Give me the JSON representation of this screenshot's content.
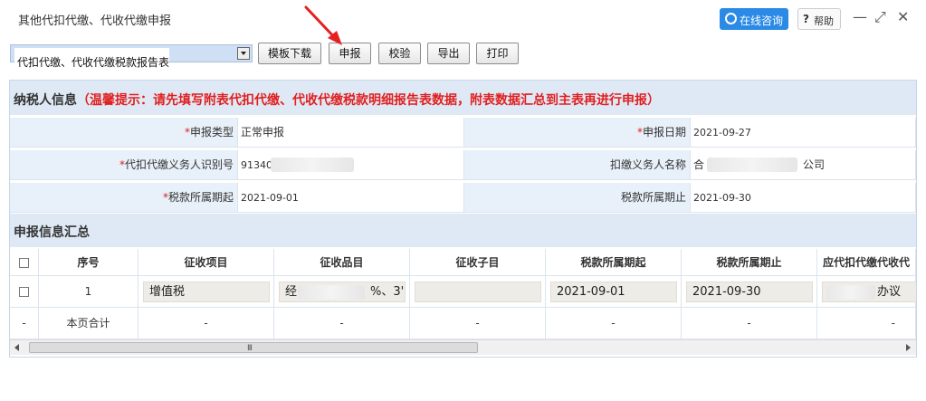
{
  "window": {
    "title": "其他代扣代缴、代收代缴申报",
    "consult_label": "在线咨询",
    "help_icon": "?",
    "help_label": "帮助",
    "minimize": "—",
    "maximize": "⤢",
    "close": "✕"
  },
  "toolbar": {
    "report_select": "代扣代缴、代收代缴税款报告表",
    "buttons": [
      "模板下载",
      "申报",
      "校验",
      "导出",
      "打印"
    ]
  },
  "taxpayer": {
    "section_title": "纳税人信息",
    "warning": "（温馨提示：请先填写附表代扣代缴、代收代缴税款明细报告表数据，附表数据汇总到主表再进行申报）",
    "required_mark": "*",
    "fields": {
      "report_type_label": "申报类型",
      "report_type": "正常申报",
      "report_date_label": "申报日期",
      "report_date": "2021-09-27",
      "agent_id_label": "代扣代缴义务人识别号",
      "agent_id": "91340",
      "agent_name_label": "扣缴义务人名称",
      "agent_name_prefix": "合",
      "agent_name_suffix": "公司",
      "period_start_label": "税款所属期起",
      "period_start": "2021-09-01",
      "period_end_label": "税款所属期止",
      "period_end": "2021-09-30"
    }
  },
  "summary": {
    "section_title": "申报信息汇总",
    "columns": [
      "序号",
      "征收项目",
      "征收品目",
      "征收子目",
      "税款所属期起",
      "税款所属期止",
      "应代扣代缴代收代"
    ],
    "row": {
      "seq": "1",
      "item": "增值税",
      "category_prefix": "经",
      "category_suffix": "%、3'",
      "subitem": "",
      "start": "2021-09-01",
      "end": "2021-09-30",
      "last_suffix": "办议"
    },
    "total_row": {
      "marker": "-",
      "label": "本页合计",
      "dash": "-"
    },
    "scroll_grip": "III"
  }
}
